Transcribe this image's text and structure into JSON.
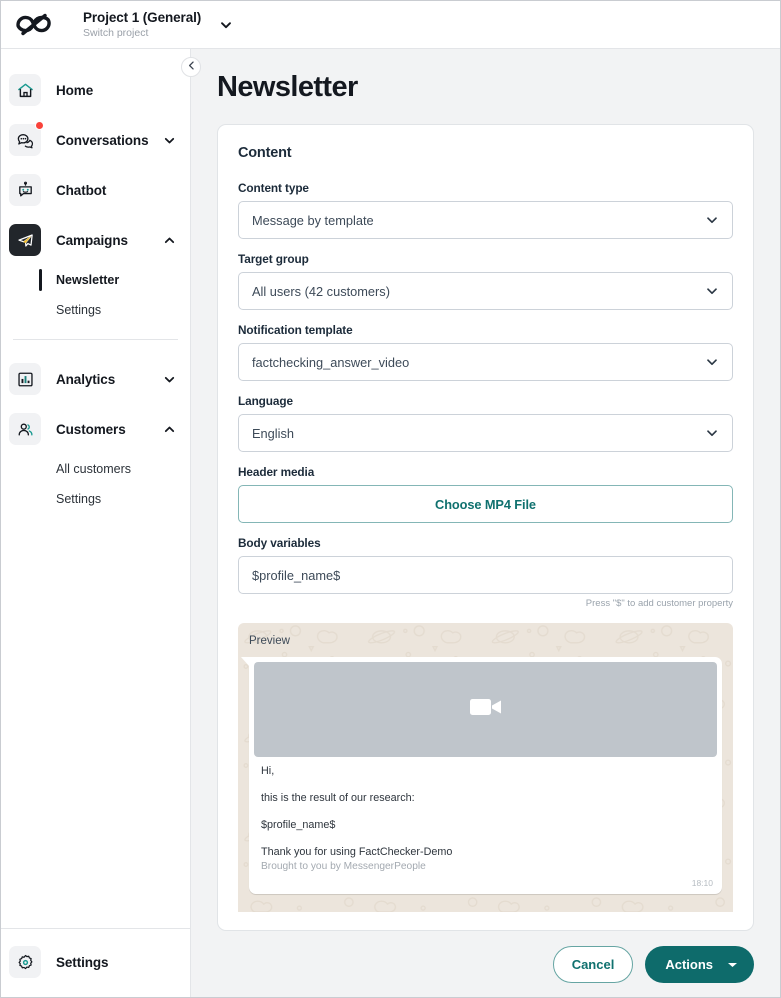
{
  "topbar": {
    "logo_icon": "messengerpeople-logo-icon",
    "project_title": "Project 1 (General)",
    "project_subtitle": "Switch project",
    "project_caret_icon": "chevron-down-icon"
  },
  "sidebar": {
    "collapse_icon": "chevron-left-icon",
    "items": [
      {
        "label": "Home",
        "icon": "home-icon",
        "expandable": false
      },
      {
        "label": "Conversations",
        "icon": "conversations-icon",
        "expandable": true,
        "badge": true
      },
      {
        "label": "Chatbot",
        "icon": "chatbot-icon",
        "expandable": false
      },
      {
        "label": "Campaigns",
        "icon": "paper-plane-icon",
        "expandable": true,
        "active": true
      },
      {
        "label": "Analytics",
        "icon": "bar-chart-icon",
        "expandable": true
      },
      {
        "label": "Customers",
        "icon": "customers-icon",
        "expandable": true
      }
    ],
    "campaigns_sub": [
      {
        "label": "Newsletter",
        "active": true
      },
      {
        "label": "Settings",
        "active": false
      }
    ],
    "customers_sub": [
      {
        "label": "All customers",
        "active": false
      },
      {
        "label": "Settings",
        "active": false
      }
    ],
    "footer": {
      "label": "Settings",
      "icon": "gear-icon"
    }
  },
  "main": {
    "page_title": "Newsletter",
    "card_title": "Content",
    "fields": {
      "content_type": {
        "label": "Content type",
        "value": "Message by template"
      },
      "target_group": {
        "label": "Target group",
        "value": "All users (42 customers)"
      },
      "notification_template": {
        "label": "Notification template",
        "value": "factchecking_answer_video"
      },
      "language": {
        "label": "Language",
        "value": "English"
      },
      "header_media": {
        "label": "Header media",
        "button": "Choose MP4 File"
      },
      "body_variables": {
        "label": "Body variables",
        "value": "$profile_name$",
        "placeholder": "$profile_name$",
        "hint": "Press \"$\" to add customer property"
      }
    },
    "preview": {
      "label": "Preview",
      "media_icon": "video-camera-icon",
      "lines": [
        "Hi,",
        "this is the result of our research:",
        "$profile_name$",
        "Thank you for using FactChecker-Demo"
      ],
      "footer": "Brought to you by MessengerPeople",
      "time": "18:10"
    },
    "buttons": {
      "cancel": "Cancel",
      "actions": "Actions",
      "actions_caret_icon": "caret-down-icon"
    }
  },
  "colors": {
    "accent_teal": "#0e6b6b",
    "accent_teal_border": "#84b6b6",
    "badge_red": "#f9423a",
    "active_dark": "#22262b",
    "text_dark": "#14181f",
    "canvas": "#f2f3f4",
    "preview_bg": "#ece5dc"
  }
}
